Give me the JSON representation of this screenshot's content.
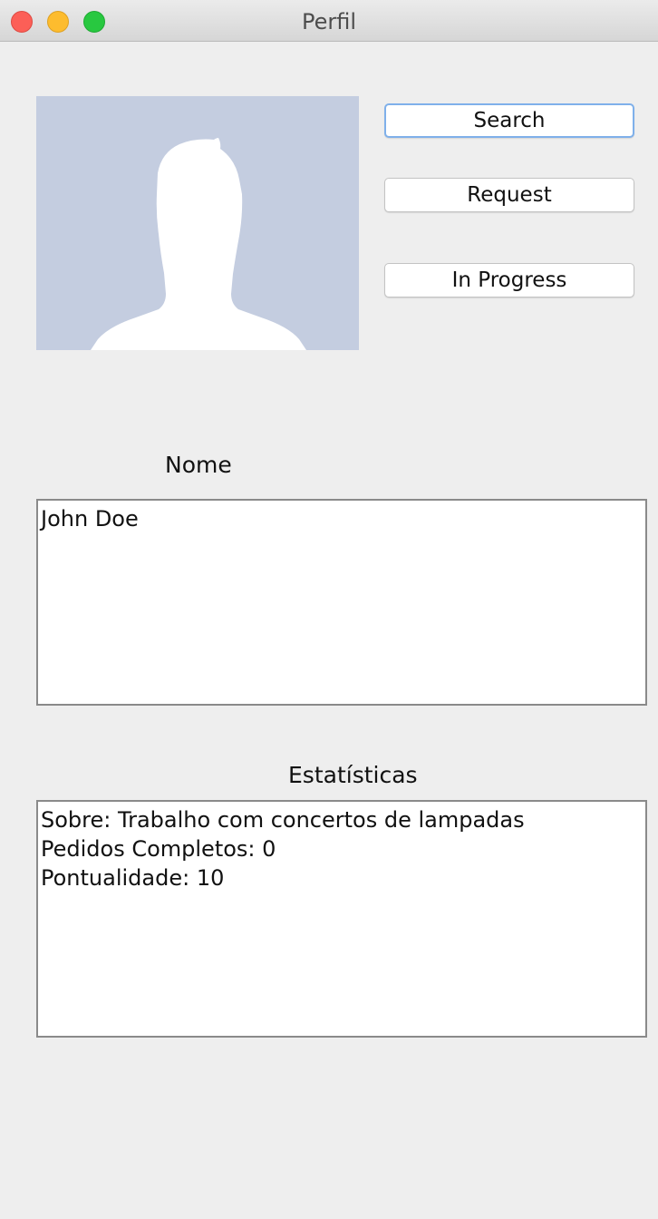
{
  "window": {
    "title": "Perfil"
  },
  "colors": {
    "avatar_background": "#c4cde0",
    "focus_ring": "#7fb0ea",
    "close": "#fc5f57",
    "minimize": "#fdbc2e",
    "maximize": "#28c840"
  },
  "buttons": {
    "search": "Search",
    "request": "Request",
    "in_progress": "In Progress"
  },
  "nome": {
    "label": "Nome",
    "value": "John Doe"
  },
  "estatisticas": {
    "label": "Estatísticas",
    "lines": [
      "Sobre: Trabalho com concertos de lampadas",
      "Pedidos Completos: 0",
      "Pontualidade: 10"
    ]
  },
  "icons": {
    "avatar": "person-silhouette-icon",
    "close": "close-icon",
    "minimize": "minimize-icon",
    "maximize": "maximize-icon"
  }
}
